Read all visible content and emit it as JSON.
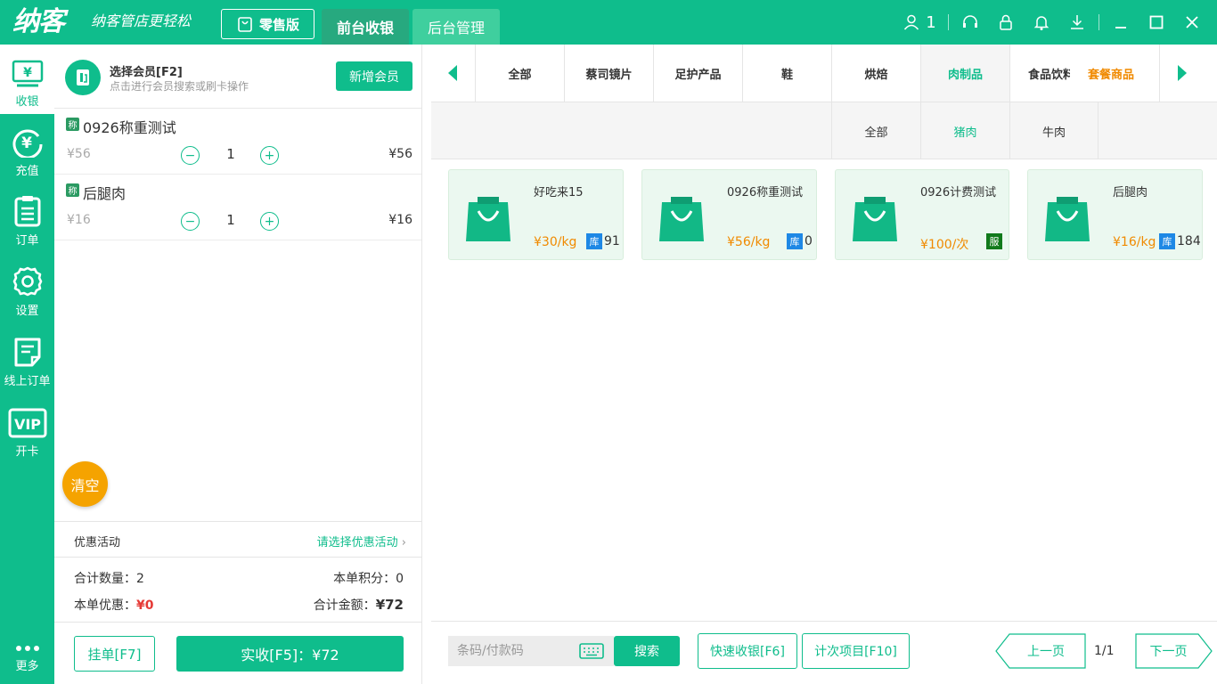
{
  "header": {
    "logo": "纳客",
    "slogan": "纳客管店更轻松",
    "edition": "零售版",
    "tabs": [
      "前台收银",
      "后台管理"
    ],
    "user_count": "1"
  },
  "sidenav": [
    {
      "label": "收银",
      "icon": "cashier-icon"
    },
    {
      "label": "充值",
      "icon": "recharge-icon"
    },
    {
      "label": "订单",
      "icon": "order-icon"
    },
    {
      "label": "设置",
      "icon": "gear-icon"
    },
    {
      "label": "线上订单",
      "icon": "online-order-icon"
    },
    {
      "label": "开卡",
      "icon": "vip-icon"
    },
    {
      "label": "更多",
      "icon": "more-icon"
    }
  ],
  "member": {
    "title": "选择会员[F2]",
    "subtitle": "点击进行会员搜索或刷卡操作",
    "add_label": "新增会员"
  },
  "cart": [
    {
      "badge": "称",
      "name": "0926称重测试",
      "price": "¥56",
      "qty": "1",
      "total": "¥56"
    },
    {
      "badge": "称",
      "name": "后腿肉",
      "price": "¥16",
      "qty": "1",
      "total": "¥16"
    }
  ],
  "clear_label": "清空",
  "promo": {
    "label": "优惠活动",
    "select": "请选择优惠活动"
  },
  "summary": {
    "count_label": "合计数量：",
    "count": "2",
    "points_label": "本单积分：",
    "points": "0",
    "discount_label": "本单优惠：",
    "discount": "¥0",
    "total_label": "合计金额：",
    "total": "¥72"
  },
  "actions": {
    "hang": "挂单[F7]",
    "pay": "实收[F5]：¥72"
  },
  "categories": [
    "全部",
    "蔡司镜片",
    "足护产品",
    "鞋",
    "烘焙",
    "肉制品",
    "食品饮料",
    "套餐商品"
  ],
  "active_category": "肉制品",
  "subcategories": [
    "全部",
    "猪肉",
    "牛肉"
  ],
  "active_subcategory": "猪肉",
  "products": [
    {
      "name": "好吃来15",
      "price": "¥30/kg",
      "badge": "库",
      "stock": "91"
    },
    {
      "name": "0926称重测试",
      "price": "¥56/kg",
      "badge": "库",
      "stock": "0"
    },
    {
      "name": "0926计费测试",
      "price": "¥100/次",
      "badge": "服",
      "stock": ""
    },
    {
      "name": "后腿肉",
      "price": "¥16/kg",
      "badge": "库",
      "stock": "184"
    }
  ],
  "bottom": {
    "search_placeholder": "条码/付款码",
    "search_label": "搜索",
    "quick_label": "快速收银[F6]",
    "timed_label": "计次项目[F10]",
    "prev_label": "上一页",
    "page": "1/1",
    "next_label": "下一页"
  },
  "colors": {
    "primary": "#0fbd8c",
    "orange": "#f5a300",
    "price": "#f08a00",
    "badge_stock": "#1e88e5",
    "badge_service": "#117a1c",
    "danger": "#e53935"
  }
}
